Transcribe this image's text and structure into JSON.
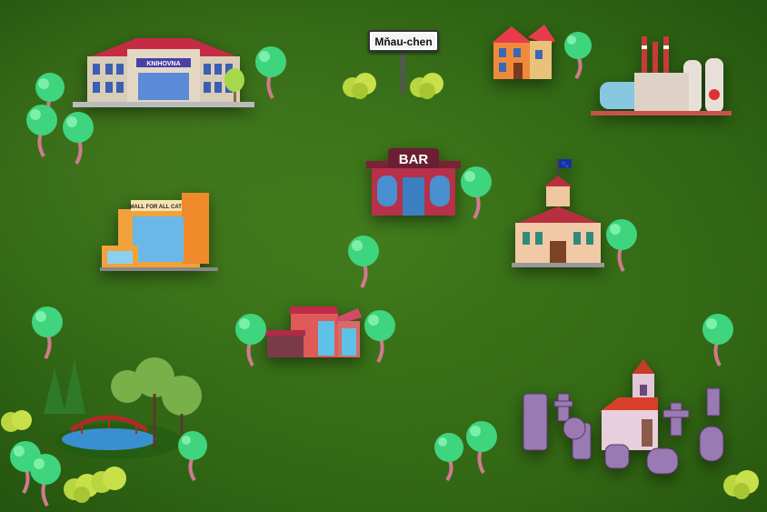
{
  "town": {
    "name": "Mňau-chen"
  },
  "buildings": {
    "library": {
      "sign": "KNIHOVNA"
    },
    "mall": {
      "sign": "MALL FOR ALL CATZ"
    },
    "bar": {
      "sign": "BAR"
    }
  },
  "colors": {
    "grass": "#3f7a1c",
    "tree": "#3fd47e",
    "trunk": "#d27a8e",
    "bush": "#b9d640"
  }
}
